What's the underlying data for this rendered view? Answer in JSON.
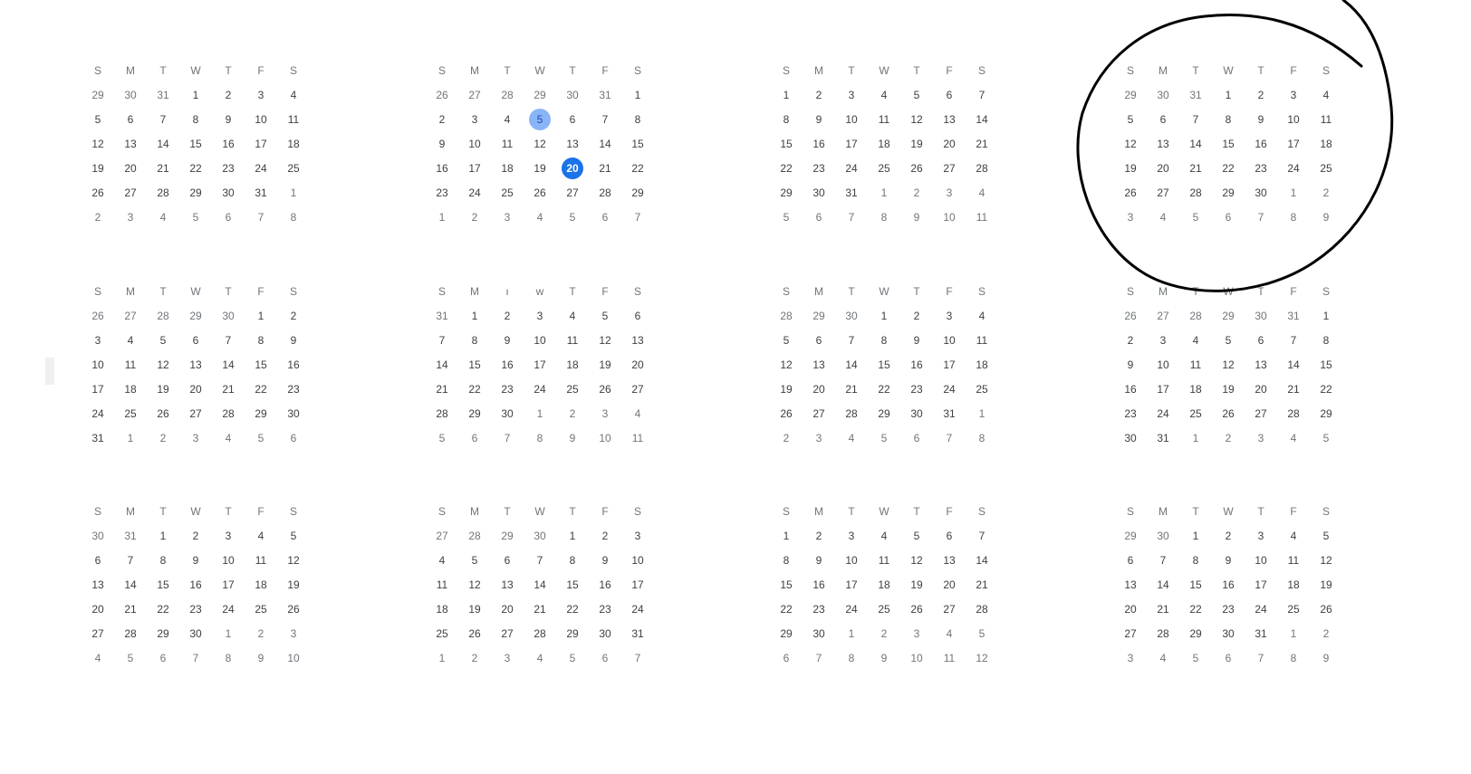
{
  "weekdays": [
    "S",
    "M",
    "T",
    "W",
    "T",
    "F",
    "S"
  ],
  "months": [
    {
      "weekdays": [
        "S",
        "M",
        "T",
        "W",
        "T",
        "F",
        "S"
      ],
      "days": [
        "29",
        "30",
        "31",
        "1",
        "2",
        "3",
        "4",
        "5",
        "6",
        "7",
        "8",
        "9",
        "10",
        "11",
        "12",
        "13",
        "14",
        "15",
        "16",
        "17",
        "18",
        "19",
        "20",
        "21",
        "22",
        "23",
        "24",
        "25",
        "26",
        "27",
        "28",
        "29",
        "30",
        "31",
        "1",
        "2",
        "3",
        "4",
        "5",
        "6",
        "7",
        "8"
      ],
      "lead_out": 3,
      "trail_out": 8
    },
    {
      "weekdays": [
        "S",
        "M",
        "T",
        "W",
        "T",
        "F",
        "S"
      ],
      "days": [
        "26",
        "27",
        "28",
        "29",
        "30",
        "31",
        "1",
        "2",
        "3",
        "4",
        "5",
        "6",
        "7",
        "8",
        "9",
        "10",
        "11",
        "12",
        "13",
        "14",
        "15",
        "16",
        "17",
        "18",
        "19",
        "20",
        "21",
        "22",
        "23",
        "24",
        "25",
        "26",
        "27",
        "28",
        "29",
        "1",
        "2",
        "3",
        "4",
        "5",
        "6",
        "7"
      ],
      "lead_out": 6,
      "trail_out": 7,
      "selected_day": "5",
      "today": "20"
    },
    {
      "weekdays": [
        "S",
        "M",
        "T",
        "W",
        "T",
        "F",
        "S"
      ],
      "days": [
        "1",
        "2",
        "3",
        "4",
        "5",
        "6",
        "7",
        "8",
        "9",
        "10",
        "11",
        "12",
        "13",
        "14",
        "15",
        "16",
        "17",
        "18",
        "19",
        "20",
        "21",
        "22",
        "23",
        "24",
        "25",
        "26",
        "27",
        "28",
        "29",
        "30",
        "31",
        "1",
        "2",
        "3",
        "4",
        "5",
        "6",
        "7",
        "8",
        "9",
        "10",
        "11"
      ],
      "lead_out": 0,
      "trail_out": 11
    },
    {
      "weekdays": [
        "S",
        "M",
        "T",
        "W",
        "T",
        "F",
        "S"
      ],
      "days": [
        "29",
        "30",
        "31",
        "1",
        "2",
        "3",
        "4",
        "5",
        "6",
        "7",
        "8",
        "9",
        "10",
        "11",
        "12",
        "13",
        "14",
        "15",
        "16",
        "17",
        "18",
        "19",
        "20",
        "21",
        "22",
        "23",
        "24",
        "25",
        "26",
        "27",
        "28",
        "29",
        "30",
        "1",
        "2",
        "3",
        "4",
        "5",
        "6",
        "7",
        "8",
        "9"
      ],
      "lead_out": 3,
      "trail_out": 9
    },
    {
      "weekdays": [
        "S",
        "M",
        "T",
        "W",
        "T",
        "F",
        "S"
      ],
      "days": [
        "26",
        "27",
        "28",
        "29",
        "30",
        "1",
        "2",
        "3",
        "4",
        "5",
        "6",
        "7",
        "8",
        "9",
        "10",
        "11",
        "12",
        "13",
        "14",
        "15",
        "16",
        "17",
        "18",
        "19",
        "20",
        "21",
        "22",
        "23",
        "24",
        "25",
        "26",
        "27",
        "28",
        "29",
        "30",
        "31",
        "1",
        "2",
        "3",
        "4",
        "5",
        "6"
      ],
      "lead_out": 5,
      "trail_out": 6
    },
    {
      "weekdays": [
        "S",
        "M",
        "ı",
        "w",
        "T",
        "F",
        "S"
      ],
      "days": [
        "31",
        "1",
        "2",
        "3",
        "4",
        "5",
        "6",
        "7",
        "8",
        "9",
        "10",
        "11",
        "12",
        "13",
        "14",
        "15",
        "16",
        "17",
        "18",
        "19",
        "20",
        "21",
        "22",
        "23",
        "24",
        "25",
        "26",
        "27",
        "28",
        "29",
        "30",
        "1",
        "2",
        "3",
        "4",
        "5",
        "6",
        "7",
        "8",
        "9",
        "10",
        "11"
      ],
      "lead_out": 1,
      "trail_out": 11
    },
    {
      "weekdays": [
        "S",
        "M",
        "T",
        "W",
        "T",
        "F",
        "S"
      ],
      "days": [
        "28",
        "29",
        "30",
        "1",
        "2",
        "3",
        "4",
        "5",
        "6",
        "7",
        "8",
        "9",
        "10",
        "11",
        "12",
        "13",
        "14",
        "15",
        "16",
        "17",
        "18",
        "19",
        "20",
        "21",
        "22",
        "23",
        "24",
        "25",
        "26",
        "27",
        "28",
        "29",
        "30",
        "31",
        "1",
        "2",
        "3",
        "4",
        "5",
        "6",
        "7",
        "8"
      ],
      "lead_out": 3,
      "trail_out": 8
    },
    {
      "weekdays": [
        "S",
        "M",
        "T",
        "W",
        "T",
        "F",
        "S"
      ],
      "days": [
        "26",
        "27",
        "28",
        "29",
        "30",
        "31",
        "1",
        "2",
        "3",
        "4",
        "5",
        "6",
        "7",
        "8",
        "9",
        "10",
        "11",
        "12",
        "13",
        "14",
        "15",
        "16",
        "17",
        "18",
        "19",
        "20",
        "21",
        "22",
        "23",
        "24",
        "25",
        "26",
        "27",
        "28",
        "29",
        "30",
        "31",
        "1",
        "2",
        "3",
        "4",
        "5"
      ],
      "lead_out": 6,
      "trail_out": 5
    },
    {
      "weekdays": [
        "S",
        "M",
        "T",
        "W",
        "T",
        "F",
        "S"
      ],
      "days": [
        "30",
        "31",
        "1",
        "2",
        "3",
        "4",
        "5",
        "6",
        "7",
        "8",
        "9",
        "10",
        "11",
        "12",
        "13",
        "14",
        "15",
        "16",
        "17",
        "18",
        "19",
        "20",
        "21",
        "22",
        "23",
        "24",
        "25",
        "26",
        "27",
        "28",
        "29",
        "30",
        "1",
        "2",
        "3",
        "4",
        "5",
        "6",
        "7",
        "8",
        "9",
        "10"
      ],
      "lead_out": 2,
      "trail_out": 10
    },
    {
      "weekdays": [
        "S",
        "M",
        "T",
        "W",
        "T",
        "F",
        "S"
      ],
      "days": [
        "27",
        "28",
        "29",
        "30",
        "1",
        "2",
        "3",
        "4",
        "5",
        "6",
        "7",
        "8",
        "9",
        "10",
        "11",
        "12",
        "13",
        "14",
        "15",
        "16",
        "17",
        "18",
        "19",
        "20",
        "21",
        "22",
        "23",
        "24",
        "25",
        "26",
        "27",
        "28",
        "29",
        "30",
        "31",
        "1",
        "2",
        "3",
        "4",
        "5",
        "6",
        "7"
      ],
      "lead_out": 4,
      "trail_out": 7
    },
    {
      "weekdays": [
        "S",
        "M",
        "T",
        "W",
        "T",
        "F",
        "S"
      ],
      "days": [
        "1",
        "2",
        "3",
        "4",
        "5",
        "6",
        "7",
        "8",
        "9",
        "10",
        "11",
        "12",
        "13",
        "14",
        "15",
        "16",
        "17",
        "18",
        "19",
        "20",
        "21",
        "22",
        "23",
        "24",
        "25",
        "26",
        "27",
        "28",
        "29",
        "30",
        "1",
        "2",
        "3",
        "4",
        "5",
        "6",
        "7",
        "8",
        "9",
        "10",
        "11",
        "12"
      ],
      "lead_out": 0,
      "trail_out": 12
    },
    {
      "weekdays": [
        "S",
        "M",
        "T",
        "W",
        "T",
        "F",
        "S"
      ],
      "days": [
        "29",
        "30",
        "1",
        "2",
        "3",
        "4",
        "5",
        "6",
        "7",
        "8",
        "9",
        "10",
        "11",
        "12",
        "13",
        "14",
        "15",
        "16",
        "17",
        "18",
        "19",
        "20",
        "21",
        "22",
        "23",
        "24",
        "25",
        "26",
        "27",
        "28",
        "29",
        "30",
        "31",
        "1",
        "2",
        "3",
        "4",
        "5",
        "6",
        "7",
        "8",
        "9"
      ],
      "lead_out": 2,
      "trail_out": 9
    }
  ],
  "colors": {
    "selected_fill": "#8ab4f8",
    "today_fill": "#1a73e8",
    "in_month_text": "#3c4043",
    "out_month_text": "#70757a",
    "annotation_stroke": "#000000"
  },
  "annotation": {
    "type": "hand-drawn-circle",
    "target": "month-4"
  }
}
